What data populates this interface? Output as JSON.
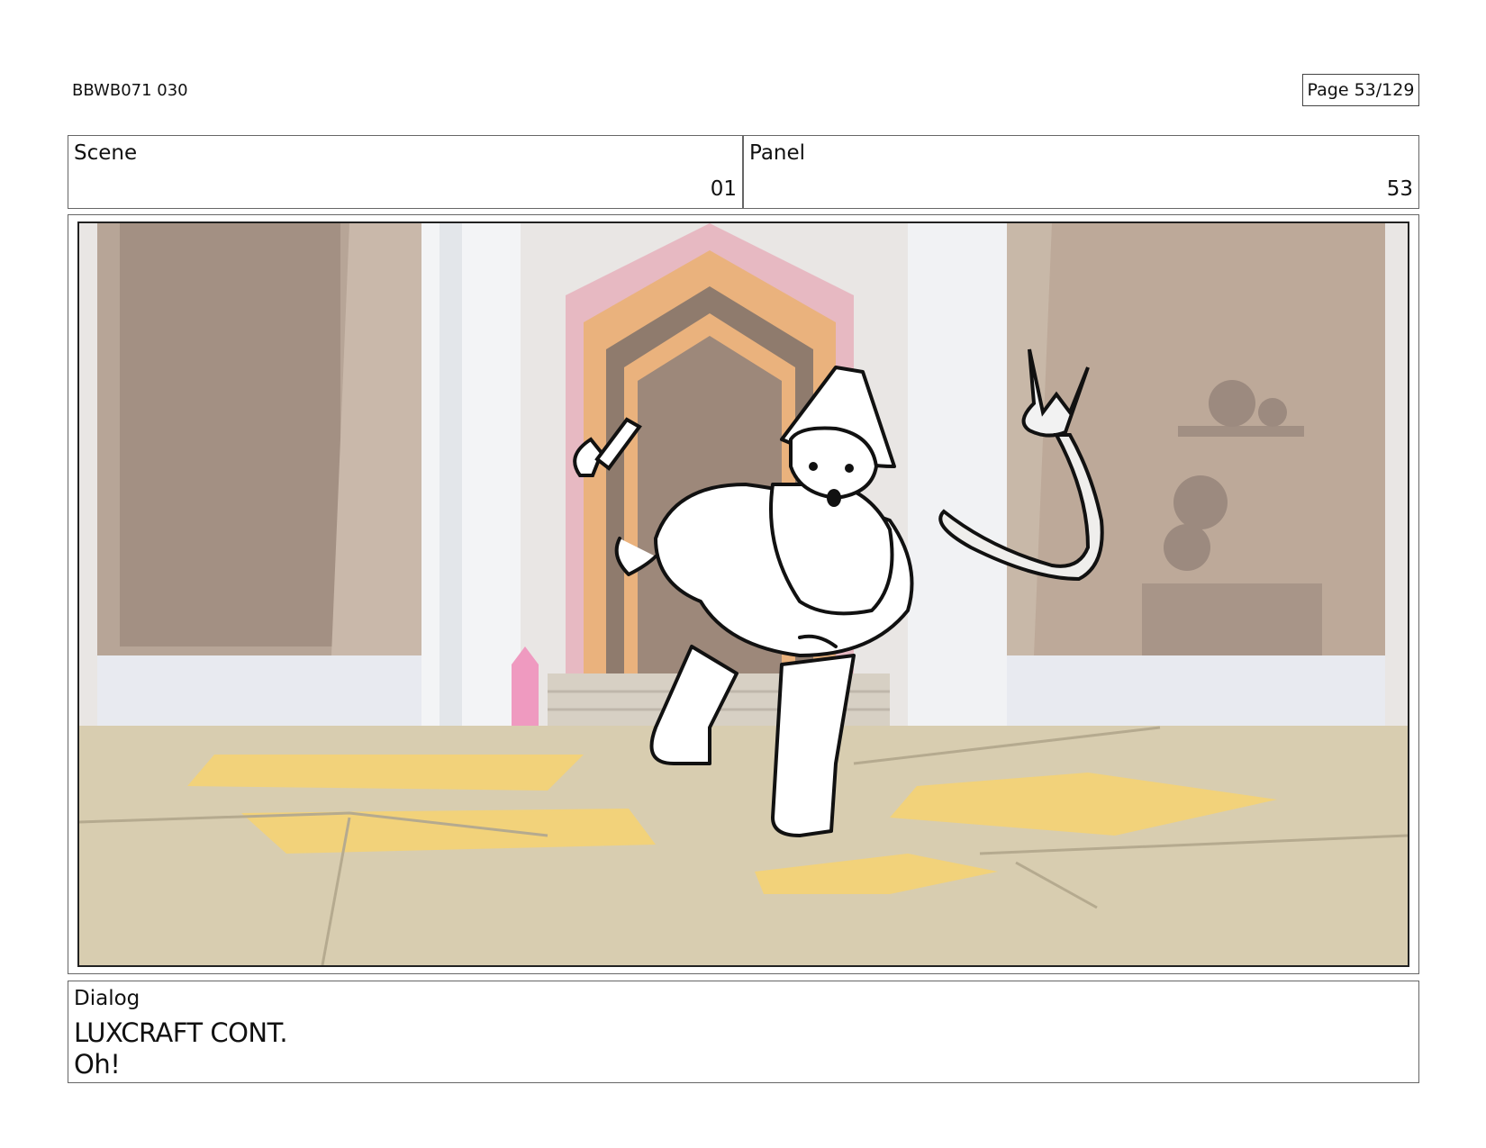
{
  "header": {
    "doc_id": "BBWB071 030",
    "page": "Page  53/129"
  },
  "scene": {
    "label": "Scene",
    "value": "01"
  },
  "panel": {
    "label": "Panel",
    "value": "53"
  },
  "dialog": {
    "label": "Dialog",
    "lines": [
      "LUXCRAFT CONT.",
      "Oh!"
    ]
  },
  "artwork": {
    "colors": {
      "wall": "#c8b8a8",
      "stone": "#a39083",
      "pillar": "#e6e8ec",
      "floor": "#d8cdb0",
      "floor_tiles": "#f2d27a",
      "door_outer": "#e7b9c2",
      "door_orange": "#eab27d",
      "door_dark": "#8f7b6d",
      "crystal": "#ef9ac0",
      "line": "#111111"
    }
  }
}
